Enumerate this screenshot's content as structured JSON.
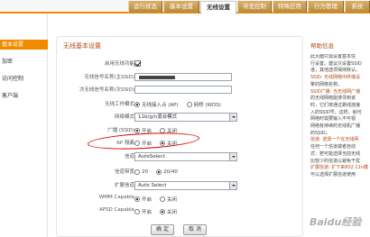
{
  "tabs": [
    "运行状态",
    "基本设置",
    "无线设置",
    "带宽控制",
    "特殊应用",
    "行为管理",
    "系统"
  ],
  "active_tab_index": 2,
  "sidebar": {
    "items": [
      "基本设置",
      "加密",
      "访问控制",
      "客户端"
    ],
    "active_index": 0
  },
  "main": {
    "title": "无线基本设置",
    "fields": {
      "enable_wireless": {
        "label": "启用无线功能",
        "checked": true
      },
      "ssid1": {
        "label": "无线信号名称(主SSID)"
      },
      "ssid2": {
        "label": "次无线信号名称(次SSID)"
      },
      "work_mode": {
        "label": "无线工作模式",
        "options": [
          "无线接入点 (AP)",
          "网桥 (WDS)"
        ],
        "selected": 0
      },
      "network_mode": {
        "label": "网络模式",
        "value": "11b/g/n混合模式"
      },
      "broadcast": {
        "label": "广播 (SSID)",
        "options": [
          "开启",
          "关闭"
        ],
        "selected": 0
      },
      "ap_isolation": {
        "label": "AP 隔离",
        "options": [
          "开启",
          "关闭"
        ],
        "selected": 1
      },
      "channel": {
        "label": "信道",
        "value": "AutoSelect"
      },
      "bandwidth": {
        "label": "信道带宽",
        "options": [
          "20",
          "20/40"
        ],
        "selected": 1
      },
      "ext_channel": {
        "label": "扩展信道",
        "value": "Auto Select"
      },
      "wmm": {
        "label": "WMM Capable",
        "options": [
          "开启",
          "关闭"
        ],
        "selected": 0
      },
      "apsd": {
        "label": "APSD Capable",
        "options": [
          "开启",
          "关闭"
        ],
        "selected": 1
      }
    },
    "buttons": {
      "confirm": "确 定",
      "cancel": "取 消"
    }
  },
  "help": {
    "title": "帮助信息",
    "lines": [
      "此页面只需设置基本信",
      "行设置。建议只设置SSID",
      "道，其他选项保持默认。",
      "SSID: 无线网络中终端设",
      "擎的网络名称。",
      "SSID广播: 当无线网广播",
      "的无线网络能搜寻到该",
      "时，它们将通过跳线连接",
      "入的SSID号，这样，就可",
      "网络时需要输入不可视",
      "网络有持续的无线机广播",
      "的SSID。",
      "信道: 选择一个在无线网",
      "任何一个信道或者自动",
      "式：若可能选择当前无线",
      "比较少的信道以避免干扰",
      "扩展信道: 扩下来802.11n模",
      "可以选择扩展信道使用"
    ],
    "highlight_lines": [
      3,
      5,
      12,
      16
    ]
  },
  "watermark": "Baidu经验"
}
